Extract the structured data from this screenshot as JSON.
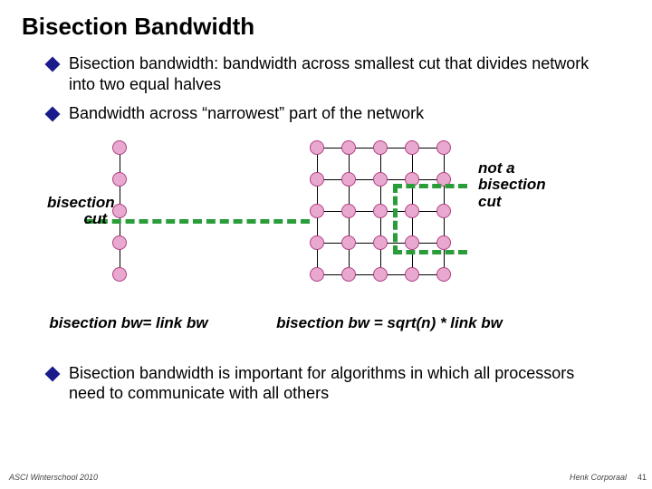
{
  "title": "Bisection Bandwidth",
  "bullets": [
    "Bisection bandwidth:  bandwidth across smallest cut that divides network into two equal halves",
    "Bandwidth across “narrowest” part of the network",
    "Bisection bandwidth is important for algorithms in which all processors need to communicate with all others"
  ],
  "labels": {
    "left_cut": "bisection cut",
    "right_cut": "not a bisection cut",
    "left_caption": "bisection bw= link bw",
    "right_caption": "bisection bw = sqrt(n) * link bw"
  },
  "footer": {
    "left": "ASCI Winterschool 2010",
    "right": "Henk Corporaal",
    "page": "41"
  }
}
